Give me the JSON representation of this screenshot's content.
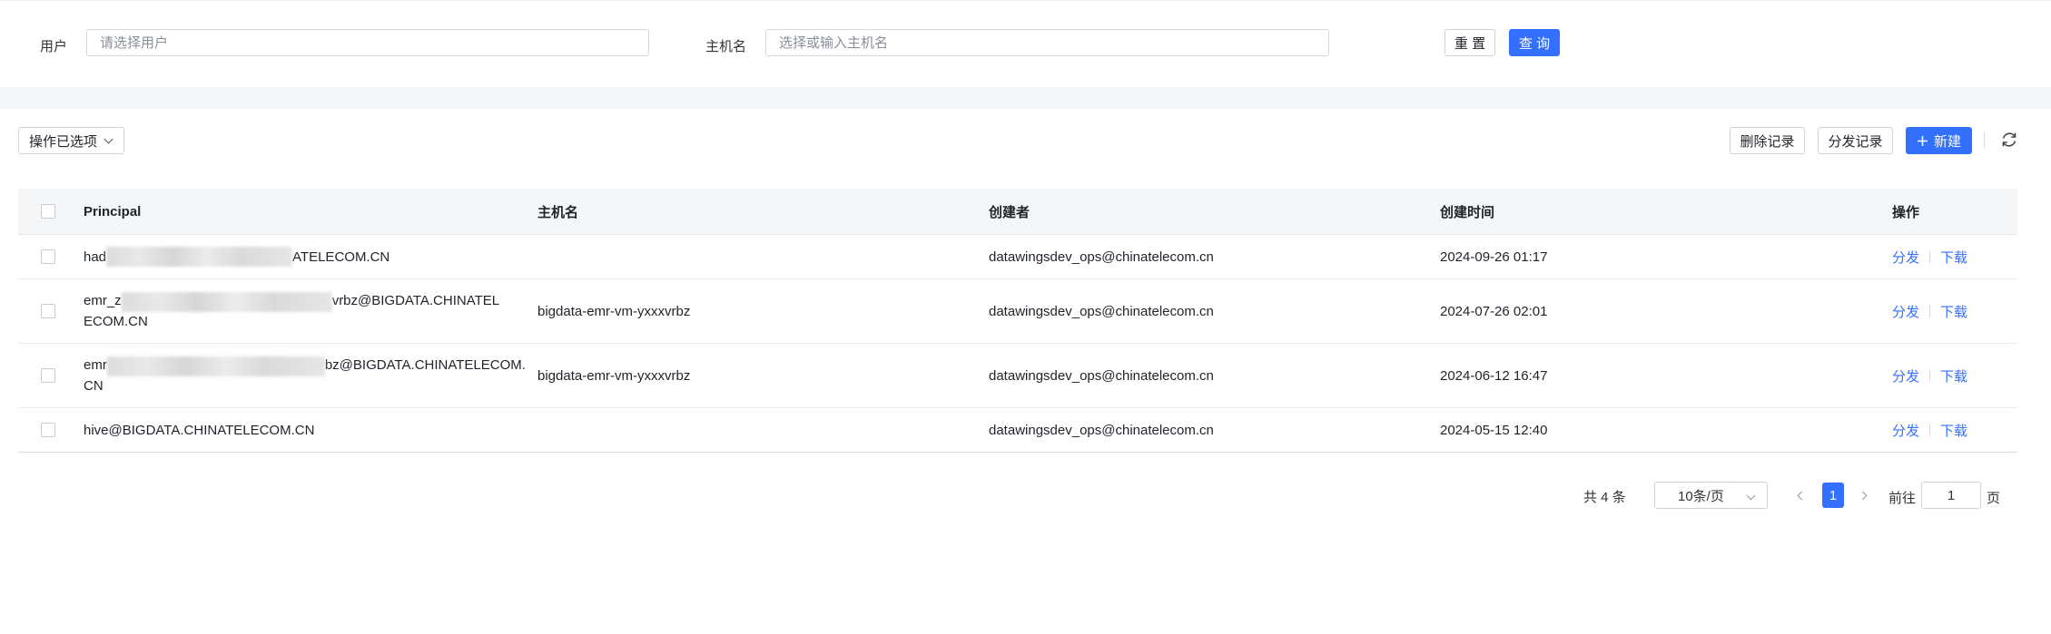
{
  "filters": {
    "user_label": "用户",
    "user_placeholder": "请选择用户",
    "host_label": "主机名",
    "host_placeholder": "选择或输入主机名",
    "reset_label": "重 置",
    "query_label": "查 询"
  },
  "toolbar": {
    "bulk_action_label": "操作已选项",
    "delete_records_label": "删除记录",
    "distribute_records_label": "分发记录",
    "new_label": "新建",
    "new_icon": "plus-icon",
    "refresh_icon": "refresh-icon"
  },
  "table": {
    "columns": {
      "principal": "Principal",
      "hostname": "主机名",
      "creator": "创建者",
      "created_time": "创建时间",
      "actions": "操作"
    },
    "rows": [
      {
        "principal_prefix": "had",
        "principal_suffix": "ATELECOM.CN",
        "hostname": "",
        "creator": "datawingsdev_ops@chinatelecom.cn",
        "created_time": "2024-09-26 01:17",
        "distribute": "分发",
        "download": "下载"
      },
      {
        "principal_prefix": "emr_z",
        "principal_suffix": "vrbz@BIGDATA.CHINATEL",
        "principal_line2": "ECOM.CN",
        "hostname": "bigdata-emr-vm-yxxxvrbz",
        "creator": "datawingsdev_ops@chinatelecom.cn",
        "created_time": "2024-07-26 02:01",
        "distribute": "分发",
        "download": "下载"
      },
      {
        "principal_prefix": "emr",
        "principal_suffix": "bz@BIGDATA.CHINATELECOM.",
        "principal_line2": "CN",
        "hostname": "bigdata-emr-vm-yxxxvrbz",
        "creator": "datawingsdev_ops@chinatelecom.cn",
        "created_time": "2024-06-12 16:47",
        "distribute": "分发",
        "download": "下载"
      },
      {
        "principal_prefix": "hive@BIGDATA.CHINATELECOM.CN",
        "principal_suffix": "",
        "hostname": "",
        "creator": "datawingsdev_ops@chinatelecom.cn",
        "created_time": "2024-05-15 12:40",
        "distribute": "分发",
        "download": "下载"
      }
    ]
  },
  "pagination": {
    "total_label": "共 4 条",
    "page_size_label": "10条/页",
    "current_page": "1",
    "goto_prefix": "前往",
    "goto_value": "1",
    "goto_suffix": "页"
  },
  "colors": {
    "primary": "#3370ff",
    "header_bg": "#f5f6f7",
    "band_bg": "#f5f6f8"
  }
}
